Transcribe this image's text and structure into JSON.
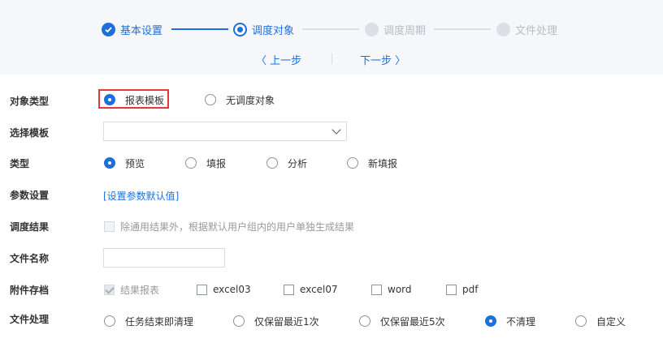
{
  "steps": [
    {
      "label": "基本设置",
      "state": "done"
    },
    {
      "label": "调度对象",
      "state": "active"
    },
    {
      "label": "调度周期",
      "state": "todo"
    },
    {
      "label": "文件处理",
      "state": "todo"
    }
  ],
  "nav": {
    "prev": "〈 上一步",
    "next": "下一步 〉"
  },
  "form": {
    "object_type": {
      "label": "对象类型",
      "options": [
        "报表模板",
        "无调度对象"
      ],
      "selected": "报表模板"
    },
    "template": {
      "label": "选择模板",
      "value": ""
    },
    "type": {
      "label": "类型",
      "options": [
        "预览",
        "填报",
        "分析",
        "新填报"
      ],
      "selected": "预览"
    },
    "params": {
      "label": "参数设置",
      "link": "[设置参数默认值]"
    },
    "result": {
      "label": "调度结果",
      "checkbox_text": "除通用结果外，根据默认用户组内的用户单独生成结果"
    },
    "file_name": {
      "label": "文件名称",
      "value": ""
    },
    "attachments": {
      "label": "附件存档",
      "options": [
        "结果报表",
        "excel03",
        "excel07",
        "word",
        "pdf"
      ],
      "checked": [
        "结果报表"
      ]
    },
    "file_handling": {
      "label": "文件处理",
      "options": [
        "任务结束即清理",
        "仅保留最近1次",
        "仅保留最近5次",
        "不清理",
        "自定义"
      ],
      "selected": "不清理"
    }
  },
  "colors": {
    "accent": "#1e6fd9",
    "highlight": "#e53935"
  }
}
